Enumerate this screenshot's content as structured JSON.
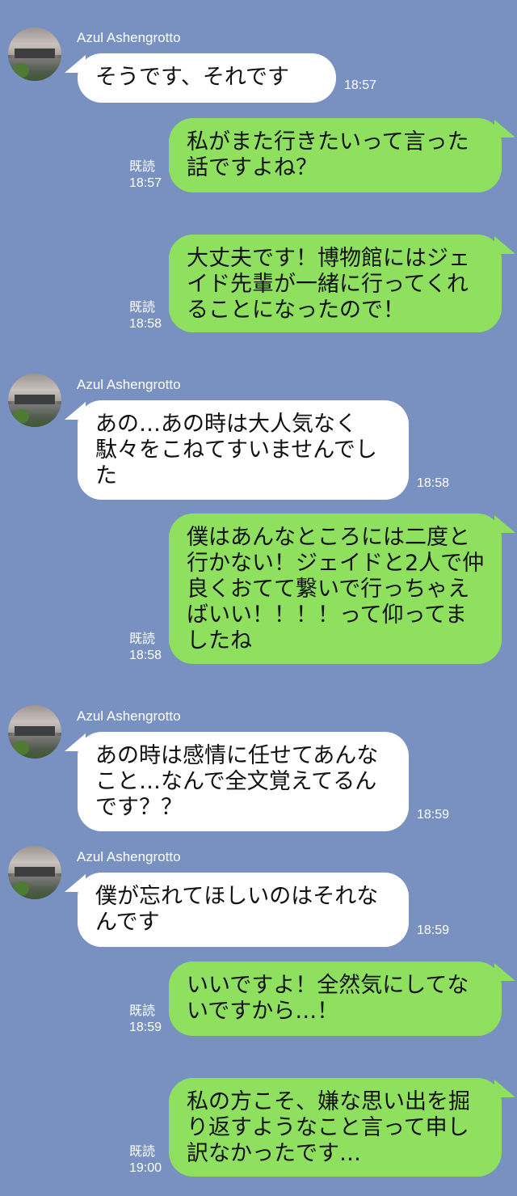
{
  "app": "LINE chat",
  "colors": {
    "background": "#7891c0",
    "incoming_bubble": "#ffffff",
    "outgoing_bubble": "#8ee05e",
    "meta_text": "#ffffff"
  },
  "read_label": "既読",
  "messages": [
    {
      "direction": "in",
      "sender": "Azul Ashengrotto",
      "avatar_icon": "user-avatar-photo",
      "text": "そうです、それです",
      "time": "18:57"
    },
    {
      "direction": "out",
      "text": "私がまた行きたいって言った話ですよね？",
      "time": "18:57",
      "read": "既読"
    },
    {
      "direction": "out",
      "text": "大丈夫です！博物館にはジェイド先輩が一緒に行ってくれることになったので！",
      "time": "18:58",
      "read": "既読"
    },
    {
      "direction": "in",
      "sender": "Azul Ashengrotto",
      "avatar_icon": "user-avatar-photo",
      "text": "あの…あの時は大人気なく駄々をこねてすいませんでした",
      "time": "18:58"
    },
    {
      "direction": "out",
      "text": "僕はあんなところには二度と行かない！ジェイドと2人で仲良くおてて繋いで行っちゃえばいい！！！！って仰ってましたね",
      "time": "18:58",
      "read": "既読"
    },
    {
      "direction": "in",
      "sender": "Azul Ashengrotto",
      "avatar_icon": "user-avatar-photo",
      "text": "あの時は感情に任せてあんなこと…なんで全文覚えてるんです？？",
      "time": "18:59"
    },
    {
      "direction": "in",
      "sender": "Azul Ashengrotto",
      "avatar_icon": "user-avatar-photo",
      "text": "僕が忘れてほしいのはそれなんです",
      "time": "18:59"
    },
    {
      "direction": "out",
      "text": "いいですよ！全然気にしてないですから…！",
      "time": "18:59",
      "read": "既読"
    },
    {
      "direction": "out",
      "text": "私の方こそ、嫌な思い出を掘り返すようなこと言って申し訳なかったです…",
      "time": "19:00",
      "read": "既読"
    }
  ]
}
